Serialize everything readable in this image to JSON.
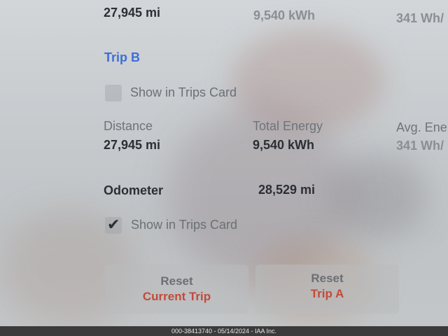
{
  "trip_a": {
    "distance_value": "27,945 mi",
    "energy_value": "9,540 kWh",
    "avg_value": "341 Wh/"
  },
  "trip_b": {
    "title": "Trip B",
    "show_in_trips_card": "Show in Trips Card",
    "distance_label": "Distance",
    "distance_value": "27,945 mi",
    "energy_label": "Total Energy",
    "energy_value": "9,540 kWh",
    "avg_label": "Avg. Ene",
    "avg_value": "341 Wh/"
  },
  "odometer": {
    "label": "Odometer",
    "value": "28,529 mi",
    "show_in_trips_card": "Show in Trips Card",
    "checked": true
  },
  "buttons": {
    "reset_current_line1": "Reset",
    "reset_current_line2": "Current Trip",
    "reset_trip_a_line1": "Reset",
    "reset_trip_a_line2": "Trip A"
  },
  "footer": {
    "watermark": "000-38413740 - 05/14/2024 - IAA Inc."
  },
  "colors": {
    "accent": "#3d6fd6",
    "reset_red": "#c24b3a"
  }
}
